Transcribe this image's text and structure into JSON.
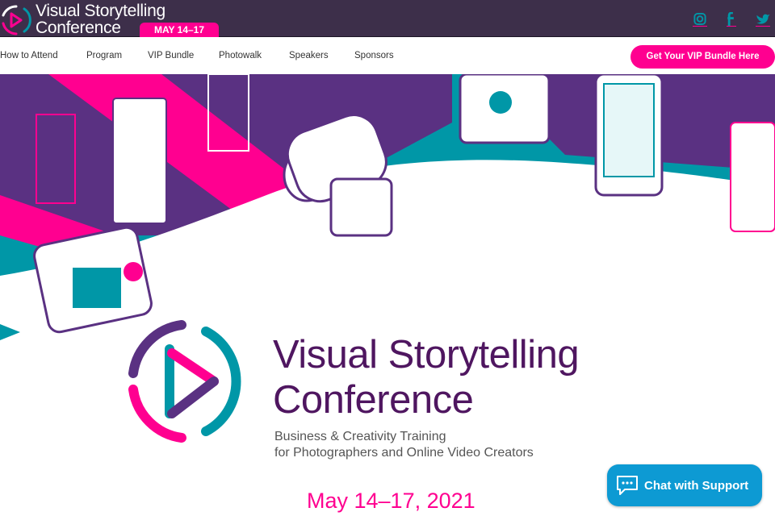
{
  "header": {
    "logo_line1": "Visual Storytelling",
    "logo_line2": "Conference",
    "date_badge": "MAY 14–17",
    "social": [
      {
        "icon": "instagram-icon"
      },
      {
        "icon": "facebook-icon"
      },
      {
        "icon": "twitter-icon"
      }
    ]
  },
  "nav": {
    "items": [
      {
        "label": "How to Attend"
      },
      {
        "label": "Program"
      },
      {
        "label": "VIP Bundle"
      },
      {
        "label": "Photowalk"
      },
      {
        "label": "Speakers"
      },
      {
        "label": "Sponsors"
      }
    ],
    "cta": "Get Your VIP Bundle Here"
  },
  "hero": {
    "title_line1": "Visual Storytelling",
    "title_line2": "Conference",
    "subtitle_line1": "Business & Creativity Training",
    "subtitle_line2": "for Photographers and Online Video Creators",
    "date": "May 14–17, 2021"
  },
  "chat": {
    "label": "Chat with Support",
    "icon": "chat-bubble-icon"
  },
  "colors": {
    "header": "#3d2f4a",
    "pink": "#ff0090",
    "teal": "#0097a7",
    "purple": "#5c2d7e",
    "title": "#4f1660",
    "chat": "#0d9ad3"
  }
}
